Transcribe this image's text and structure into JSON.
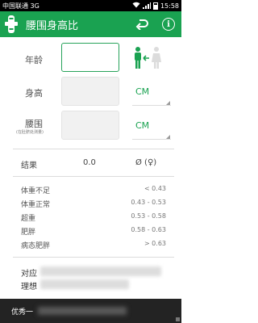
{
  "status_bar": {
    "carrier": "中国联通 3G",
    "time": "15:58",
    "icons": [
      "usb-icon",
      "android-icon",
      "mail-icon",
      "wifi-icon",
      "signal-icon",
      "battery-icon"
    ]
  },
  "app_bar": {
    "title": "腰围身高比",
    "logo_icon": "body-measure-logo-icon",
    "back_icon": "undo-arrow-icon",
    "info_label": "i"
  },
  "form": {
    "age_label": "年龄",
    "height_label": "身高",
    "waist_label": "腰围",
    "waist_hint": "(在肚脐处测量)",
    "age_value": "",
    "height_value": "",
    "waist_value": "",
    "height_unit": "CM",
    "waist_unit": "CM",
    "gender_icon": "male-female-toggle-icon"
  },
  "result": {
    "label": "结果",
    "value": "0.0",
    "gender_text": "Ø (♀)"
  },
  "ranges": [
    {
      "name": "体重不足",
      "value": "< 0.43"
    },
    {
      "name": "体重正常",
      "value": "0.43 - 0.53"
    },
    {
      "name": "超重",
      "value": "0.53 - 0.58"
    },
    {
      "name": "肥胖",
      "value": "0.58 - 0.63"
    },
    {
      "name": "病态肥胖",
      "value": "> 0.63"
    }
  ],
  "bottom": {
    "line1": "对应",
    "line2": "理想"
  },
  "banner": {
    "text": "优秀一"
  },
  "colors": {
    "primary": "#1aa251",
    "status_bar": "#000000",
    "banner": "#232323"
  }
}
